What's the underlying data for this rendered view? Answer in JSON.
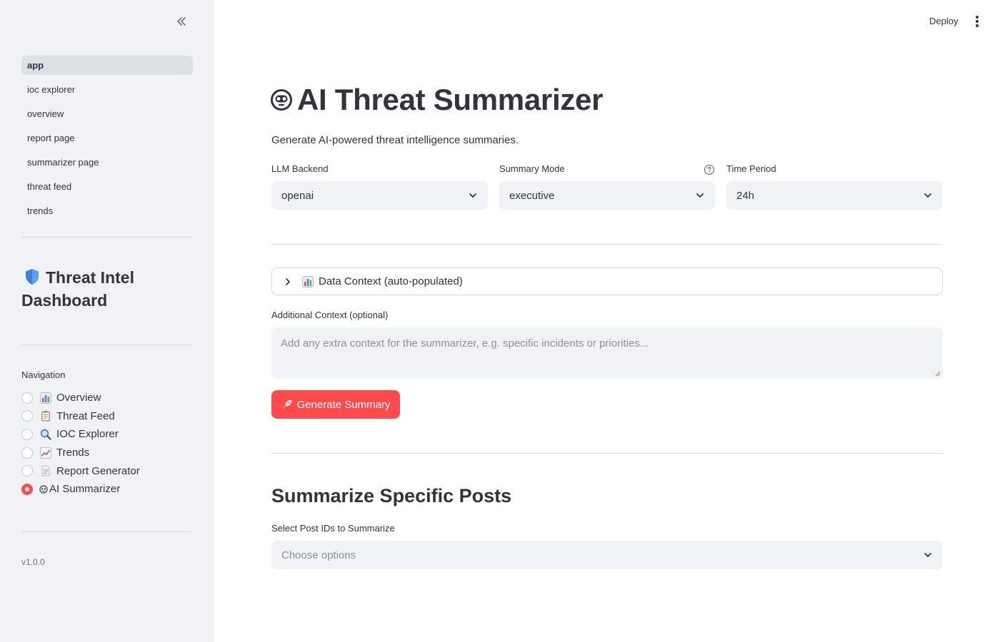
{
  "sidebar": {
    "pages": [
      {
        "label": "app"
      },
      {
        "label": "ioc explorer"
      },
      {
        "label": "overview"
      },
      {
        "label": "report page"
      },
      {
        "label": "summarizer page"
      },
      {
        "label": "threat feed"
      },
      {
        "label": "trends"
      }
    ],
    "active_page": "app",
    "dashboard_title": "Threat Intel Dashboard",
    "nav_label": "Navigation",
    "nav_options": [
      {
        "label": "Overview",
        "icon": "bar-chart-icon"
      },
      {
        "label": "Threat Feed",
        "icon": "clipboard-icon"
      },
      {
        "label": "IOC Explorer",
        "icon": "magnifier-icon"
      },
      {
        "label": "Trends",
        "icon": "trend-chart-icon"
      },
      {
        "label": "Report Generator",
        "icon": "document-icon"
      },
      {
        "label": "AI Summarizer",
        "icon": "robot-icon"
      }
    ],
    "nav_selected": "AI Summarizer",
    "version": "v1.0.0"
  },
  "header": {
    "deploy_label": "Deploy"
  },
  "main": {
    "title": "AI Threat Summarizer",
    "subtitle": "Generate AI-powered threat intelligence summaries.",
    "llm_backend": {
      "label": "LLM Backend",
      "value": "openai"
    },
    "summary_mode": {
      "label": "Summary Mode",
      "value": "executive"
    },
    "time_period": {
      "label": "Time Period",
      "value": "24h"
    },
    "data_context_label": "Data Context (auto-populated)",
    "additional_context": {
      "label": "Additional Context (optional)",
      "placeholder": "Add any extra context for the summarizer, e.g. specific incidents or priorities..."
    },
    "generate_button": "Generate Summary",
    "section_heading": "Summarize Specific Posts",
    "post_ids": {
      "label": "Select Post IDs to Summarize",
      "placeholder": "Choose options"
    }
  },
  "colors": {
    "accent": "#ff4b4b",
    "sidebar_bg": "#f0f2f6",
    "text": "#31333f"
  }
}
